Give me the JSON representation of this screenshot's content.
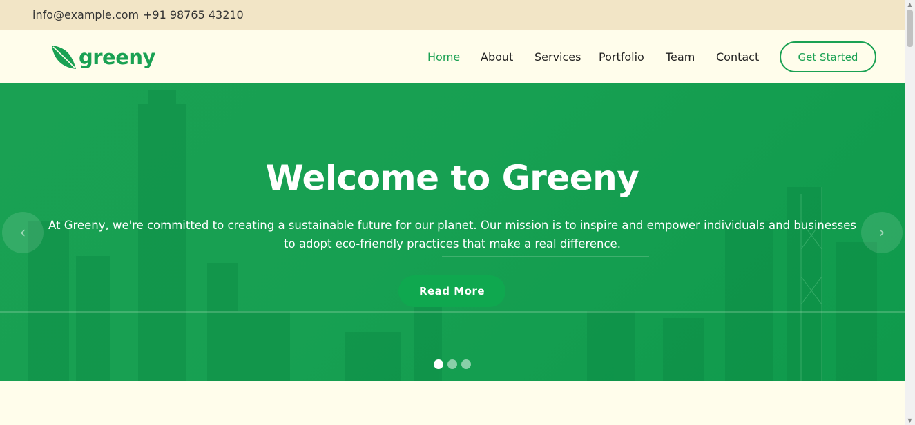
{
  "topbar": {
    "email": "info@example.com",
    "phone": "+91 98765 43210"
  },
  "header": {
    "brand": "greeny",
    "nav": [
      {
        "label": "Home",
        "active": true
      },
      {
        "label": "About"
      },
      {
        "label": "Services"
      },
      {
        "label": "Portfolio"
      },
      {
        "label": "Team"
      },
      {
        "label": "Contact"
      }
    ],
    "cta_label": "Get Started"
  },
  "hero": {
    "title": "Welcome to Greeny",
    "text": "At Greeny, we're committed to creating a sustainable future for our planet. Our mission is to inspire and empower individuals and businesses to adopt eco-friendly practices that make a real difference.",
    "button_label": "Read More",
    "prev_icon": "chevron-left-icon",
    "next_icon": "chevron-right-icon",
    "slides": 3,
    "active_slide": 1
  },
  "colors": {
    "accent": "#1aa153",
    "topbar_bg": "#f2e5c6",
    "page_bg": "#fffdeb"
  }
}
